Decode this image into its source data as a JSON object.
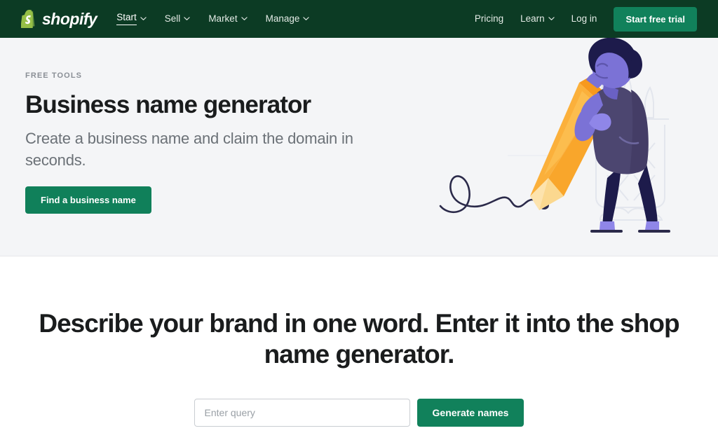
{
  "theme": {
    "header_bg": "#0c3b24",
    "brand_green": "#95bf47",
    "accent_green": "#11815b",
    "hero_bg": "#f4f5f7",
    "text_dark": "#1a1c1d",
    "text_muted": "#6b7177"
  },
  "header": {
    "logo": {
      "icon": "shopify-bag-icon",
      "wordmark": "shopify"
    },
    "nav": [
      {
        "label": "Start",
        "has_chevron": true,
        "active": true
      },
      {
        "label": "Sell",
        "has_chevron": true,
        "active": false
      },
      {
        "label": "Market",
        "has_chevron": true,
        "active": false
      },
      {
        "label": "Manage",
        "has_chevron": true,
        "active": false
      }
    ],
    "links": [
      {
        "label": "Pricing",
        "has_chevron": false
      },
      {
        "label": "Learn",
        "has_chevron": true
      },
      {
        "label": "Log in",
        "has_chevron": false
      }
    ],
    "cta_label": "Start free trial"
  },
  "hero": {
    "eyebrow": "FREE TOOLS",
    "title": "Business name generator",
    "subtitle": "Create a business name and claim the domain in seconds.",
    "cta_label": "Find a business name",
    "illustration": {
      "name": "person-pushing-giant-pencil-illustration",
      "colors": {
        "pencil_body": "#fbb03b",
        "pencil_light": "#fdc85f",
        "pencil_tip": "#fde3ad",
        "pencil_lead": "#2b2a4a",
        "hair": "#1d1b4b",
        "skin": "#7b72d6",
        "coat": "#4c4670",
        "legs": "#1d1b4b",
        "shoes": "#8f86e8",
        "squiggle": "#2b2a4a",
        "bg_outline": "#e8eaf0"
      }
    }
  },
  "main": {
    "heading": "Describe your brand in one word. Enter it into the shop name generator.",
    "search": {
      "placeholder": "Enter query",
      "value": "",
      "button_label": "Generate names"
    }
  }
}
